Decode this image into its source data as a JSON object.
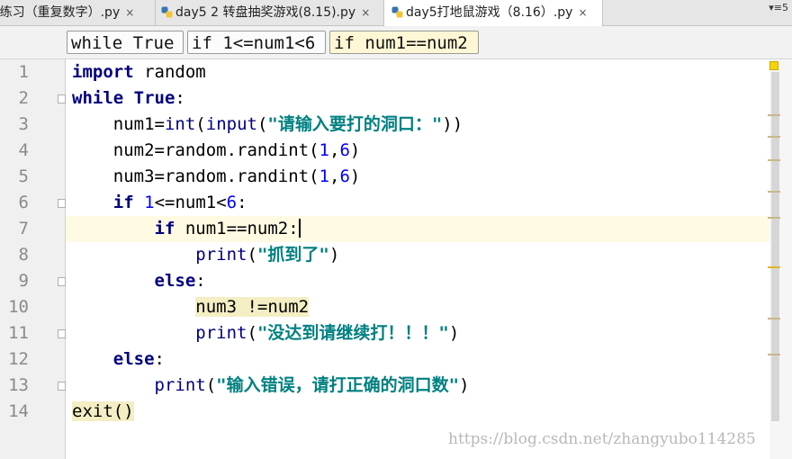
{
  "tabs": [
    {
      "label": "!练习（重复数字）.py",
      "active": false
    },
    {
      "label": "day5 2 转盘抽奖游戏(8.15).py",
      "active": false
    },
    {
      "label": "day5打地鼠游戏（8.16）.py",
      "active": true
    }
  ],
  "tab_close_glyph": "×",
  "tab_menu_label": "▾≡5",
  "breadcrumbs": [
    "while True",
    "if 1<=num1<6",
    "if num1==num2"
  ],
  "line_numbers": [
    "1",
    "2",
    "3",
    "4",
    "5",
    "6",
    "7",
    "8",
    "9",
    "10",
    "11",
    "12",
    "13",
    "14"
  ],
  "code": {
    "l1": {
      "kw": "import",
      "rest": " random"
    },
    "l2": {
      "kw": "while",
      "val": "True",
      "rest": ":"
    },
    "l3": {
      "a": "num1=",
      "b": "int",
      "c": "(",
      "d": "input",
      "e": "(",
      "s": "\"请输入要打的洞口：\"",
      "f": "))"
    },
    "l4": {
      "a": "num2=random.randint(",
      "n1": "1",
      "c": ",",
      "n2": "6",
      "e": ")"
    },
    "l5": {
      "a": "num3=random.randint(",
      "n1": "1",
      "c": ",",
      "n2": "6",
      "e": ")"
    },
    "l6": {
      "kw": "if",
      "n1": "1",
      "a": "<=num1<",
      "n2": "6",
      "e": ":"
    },
    "l7": {
      "kw": "if",
      "rest": " num1==num2:"
    },
    "l8": {
      "fn": "print",
      "a": "(",
      "s": "\"抓到了\"",
      "e": ")"
    },
    "l9": {
      "kw": "else",
      "rest": ":"
    },
    "l10": {
      "hl": "num3 !=num2"
    },
    "l11": {
      "fn": "print",
      "a": "(",
      "s": "\"没达到请继续打！！！\"",
      "e": ")"
    },
    "l12": {
      "kw": "else",
      "rest": ":"
    },
    "l13": {
      "fn": "print",
      "a": "(",
      "s": "\"输入错误，请打正确的洞口数\"",
      "e": ")"
    },
    "l14": {
      "hl": "exit()"
    }
  },
  "watermark": "https://blog.csdn.net/zhangyubo114285"
}
